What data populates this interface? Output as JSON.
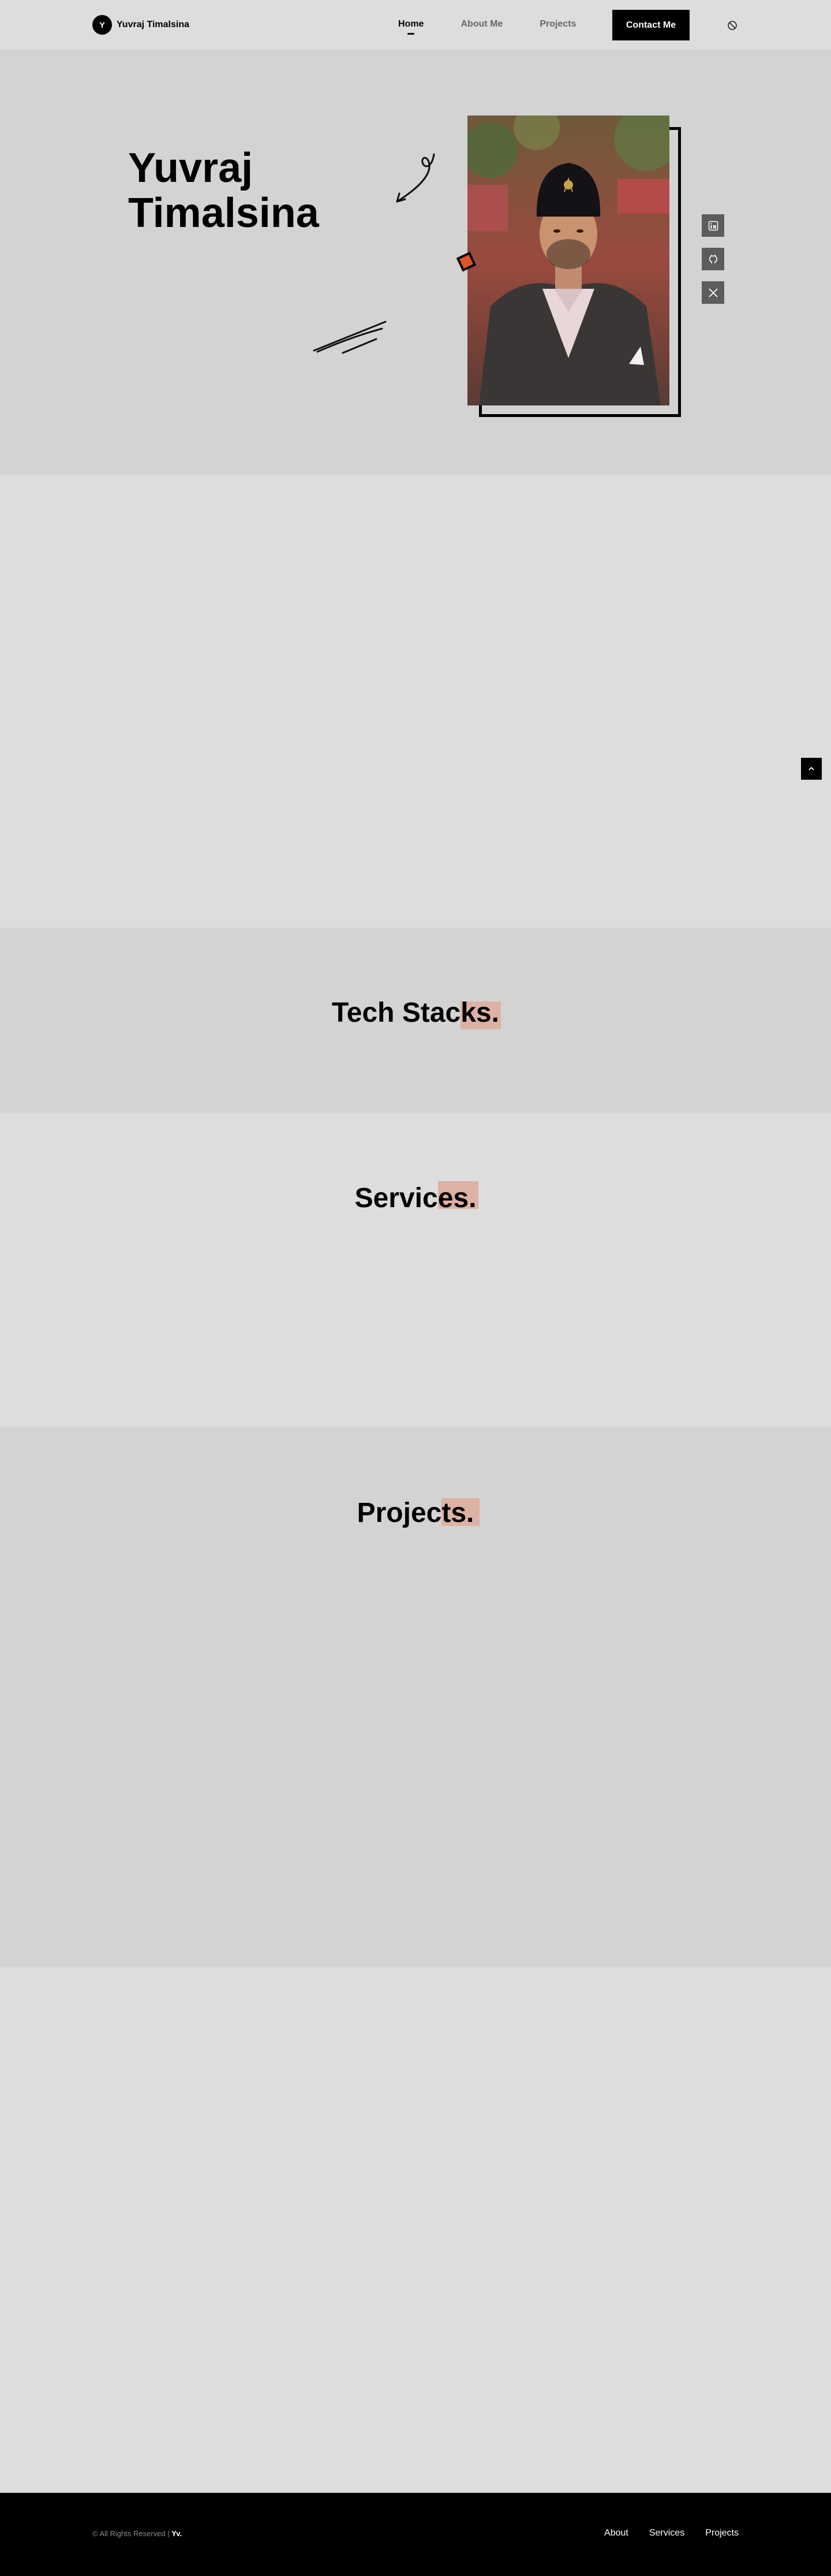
{
  "nav": {
    "brand_initial": "Y",
    "brand_name": "Yuvraj Timalsina",
    "links": [
      "Home",
      "About Me",
      "Projects"
    ],
    "active": "Home",
    "contact_label": "Contact Me",
    "theme_icon": "moon-icon"
  },
  "hero": {
    "name_line1": "Yuvraj",
    "name_line2": "Timalsina",
    "photo_icon": "profile-photo",
    "social": [
      "linkedin-icon",
      "github-icon",
      "x-twitter-icon"
    ]
  },
  "sections": {
    "tech_title_a": "Tech Stac",
    "tech_title_b": "ks.",
    "services_title_a": "Servic",
    "services_title_b": "es.",
    "projects_title_a": "Projec",
    "projects_title_b": "ts."
  },
  "footer": {
    "copyright": "© All Rights Reserved |",
    "brand_short": "Yv.",
    "links": [
      "About",
      "Services",
      "Projects"
    ]
  },
  "colors": {
    "background": "#dddddd",
    "section_alt": "#d3d3d3",
    "highlight": "#ddb2a4",
    "accent_orange": "#e0522a",
    "footer": "#000000"
  }
}
